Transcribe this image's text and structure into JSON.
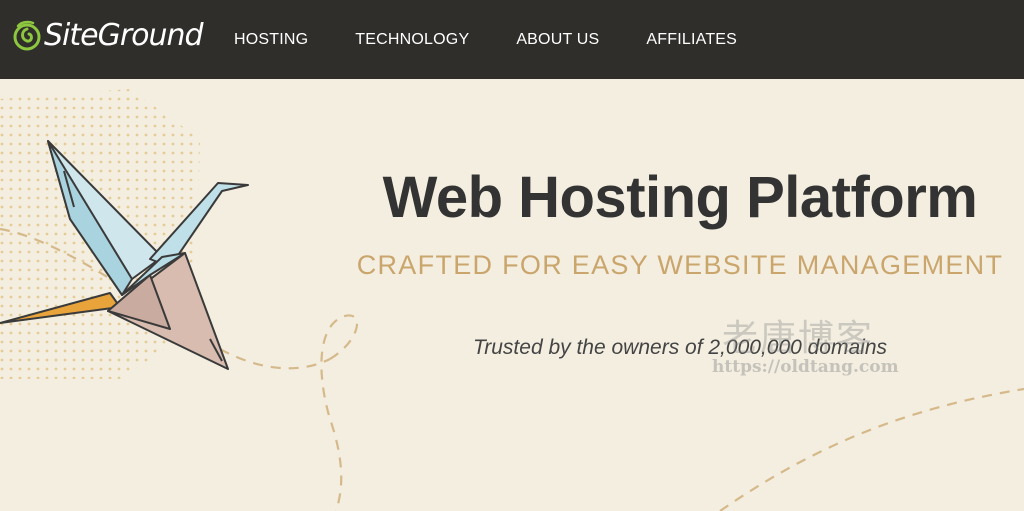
{
  "header": {
    "logo_text": "SiteGround",
    "nav": [
      {
        "label": "HOSTING"
      },
      {
        "label": "TECHNOLOGY"
      },
      {
        "label": "ABOUT US"
      },
      {
        "label": "AFFILIATES"
      }
    ]
  },
  "hero": {
    "title": "Web Hosting Platform",
    "subtitle": "CRAFTED FOR EASY WEBSITE MANAGEMENT",
    "trusted_text": "Trusted by the owners of 2,000,000 domains",
    "illustration": "origami-crane"
  },
  "watermark": {
    "text_cn": "老唐博客",
    "url": "https://oldtang.com"
  },
  "colors": {
    "header_bg": "#2f2e2b",
    "page_bg": "#f3eee0",
    "accent_gold": "#caa56c",
    "logo_green": "#8dc63f",
    "headline": "#333333"
  }
}
